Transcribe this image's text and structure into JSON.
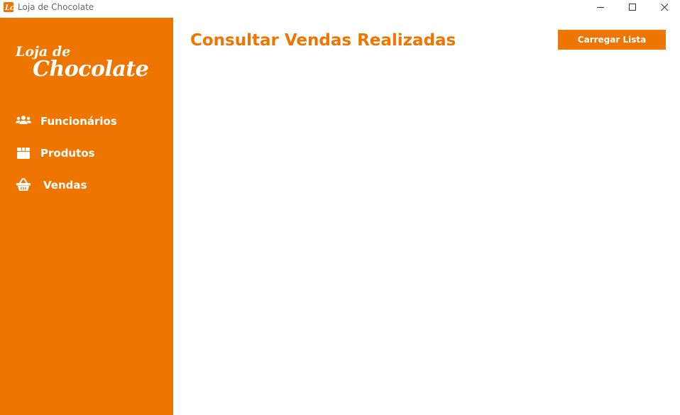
{
  "window": {
    "title": "Loja de Chocolate"
  },
  "sidebar": {
    "logo_line1": "Loja de",
    "logo_line2": "Chocolate",
    "items": [
      {
        "label": "Funcionários",
        "icon": "users-icon"
      },
      {
        "label": "Produtos",
        "icon": "box-icon"
      },
      {
        "label": "Vendas",
        "icon": "basket-icon"
      }
    ]
  },
  "main": {
    "title": "Consultar Vendas Realizadas",
    "load_button_label": "Carregar Lista"
  },
  "colors": {
    "accent": "#ee7600",
    "background": "#ffffff",
    "sidebar_text": "#ffffff"
  }
}
